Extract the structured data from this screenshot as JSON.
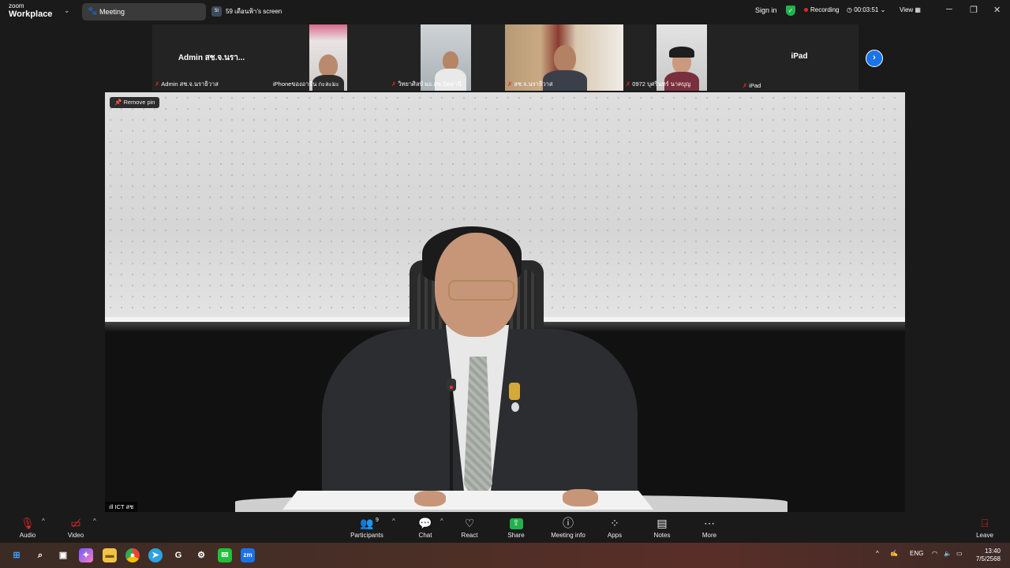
{
  "titlebar": {
    "logo_small": "zoom",
    "logo_big": "Workplace",
    "tab_meeting": "Meeting",
    "tab_share_badge": "5t",
    "tab_share": "59 เดือนฟ้า's screen",
    "sign_in": "Sign in",
    "recording": "Recording",
    "timer": "00:03:51",
    "view": "View"
  },
  "participants_strip": {
    "tiles": [
      {
        "display": "Admin สช.จ.นรา...",
        "caption": "Admin สช.จ.นราธิวาส"
      },
      {
        "display": "",
        "caption": "iPhoneของอามีน กะละมะ"
      },
      {
        "display": "",
        "caption": "วิทยาศิลป์ ผอ.สช.ปัตตานี"
      },
      {
        "display": "",
        "caption": "สช.จ.นราธิวาส"
      },
      {
        "display": "",
        "caption": "0972 บุศรินทร์ นาคบุญ"
      },
      {
        "display": "iPad",
        "caption": "iPad"
      }
    ]
  },
  "main_video": {
    "remove_pin": "Remove pin",
    "speaker_label": "ICT สช"
  },
  "toolbar": {
    "audio": "Audio",
    "video": "Video",
    "participants": "Participants",
    "participant_count": "9",
    "chat": "Chat",
    "react": "React",
    "share": "Share",
    "meeting_info": "Meeting info",
    "apps": "Apps",
    "notes": "Notes",
    "more": "More",
    "leave": "Leave"
  },
  "taskbar": {
    "language": "ENG",
    "time": "13:40",
    "date": "7/5/2568"
  },
  "colors": {
    "recording_dot": "#e02828",
    "share_green": "#23b14d",
    "accent_blue": "#1a73e8"
  }
}
